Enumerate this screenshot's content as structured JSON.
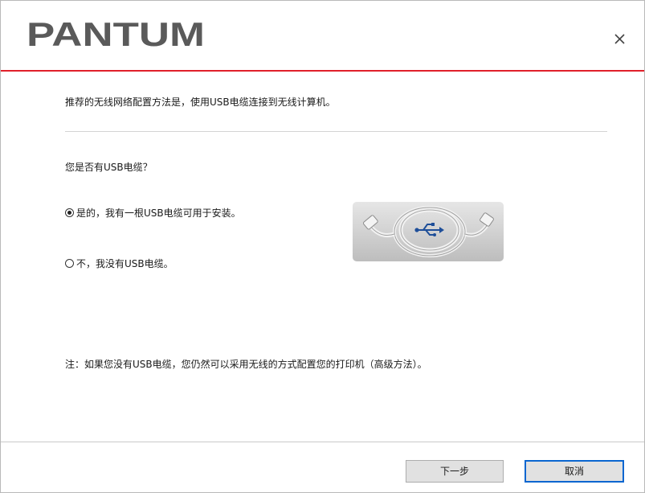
{
  "app": {
    "brand": "PANTUM",
    "brand_color": "#5a5a5a",
    "accent_color": "#e0202a"
  },
  "header": {
    "close_icon": "close-icon"
  },
  "main": {
    "recommendation_text": "推荐的无线网络配置方法是，使用USB电缆连接到无线计算机。",
    "question": "您是否有USB电缆？",
    "options": [
      {
        "label": "是的，我有一根USB电缆可用于安装。",
        "selected": true
      },
      {
        "label": "不，我没有USB电缆。",
        "selected": false
      }
    ],
    "image_icon": "usb-cable-image",
    "note": "注：如果您没有USB电缆，您仍然可以采用无线的方式配置您的打印机（高级方法）。"
  },
  "footer": {
    "next_label": "下一步",
    "cancel_label": "取消"
  }
}
